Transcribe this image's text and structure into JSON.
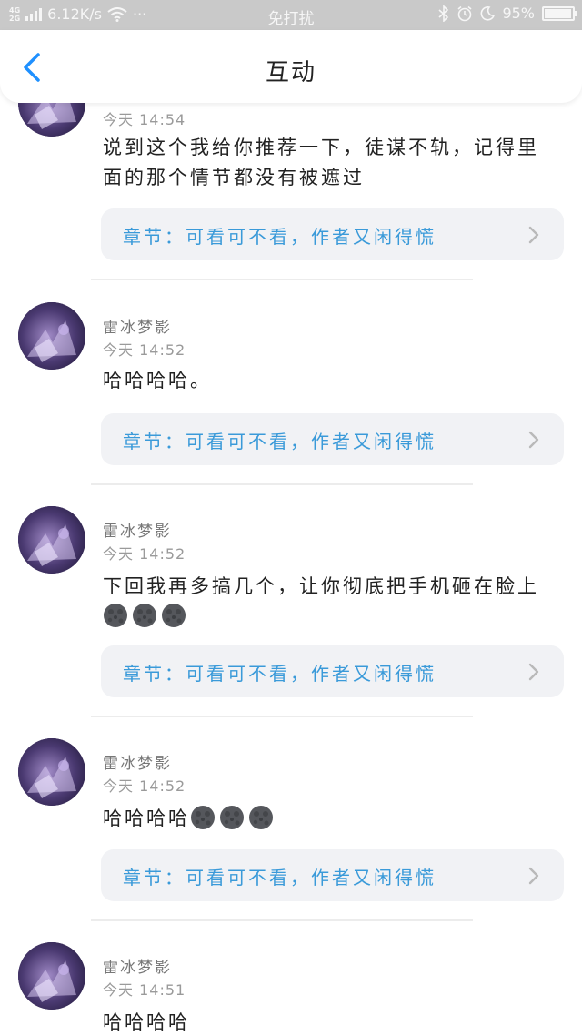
{
  "status_bar": {
    "signal_top": "4G",
    "signal_bottom": "2G",
    "speed": "6.12K/s",
    "more": "···",
    "mode": "免打扰",
    "battery": "95%",
    "battery_level": 0.95
  },
  "header": {
    "title": "互动"
  },
  "chapter_prefix": "章节：",
  "posts": [
    {
      "name": "",
      "time": "今天 14:54",
      "text": "说到这个我给你推荐一下，徒谋不轨，记得里面的那个情节都没有被遮过",
      "emoji_count": 0,
      "chapter": "可看可不看，作者又闲得慌"
    },
    {
      "name": "雷冰梦影",
      "time": "今天 14:52",
      "text": "哈哈哈哈。",
      "emoji_count": 0,
      "chapter": "可看可不看，作者又闲得慌"
    },
    {
      "name": "雷冰梦影",
      "time": "今天 14:52",
      "text": "下回我再多搞几个，让你彻底把手机砸在脸上",
      "emoji_count": 3,
      "chapter": "可看可不看，作者又闲得慌"
    },
    {
      "name": "雷冰梦影",
      "time": "今天 14:52",
      "text": "哈哈哈哈",
      "emoji_count": 3,
      "chapter": "可看可不看，作者又闲得慌"
    },
    {
      "name": "雷冰梦影",
      "time": "今天 14:51",
      "text": "哈哈哈哈",
      "emoji_count": 0,
      "chapter": ""
    }
  ],
  "icons": {
    "back": "chevron-left-icon",
    "chapter_arrow": "chevron-right-icon",
    "emoji": "new-moon-face-icon",
    "wifi": "wifi-icon",
    "bluetooth": "bluetooth-icon",
    "alarm": "alarm-icon",
    "night": "moon-icon"
  },
  "colors": {
    "accent": "#3a9ad9",
    "back_arrow": "#1e90ff",
    "status_bar_bg": "#c9c9c9",
    "chapter_bg": "#f1f2f5"
  }
}
